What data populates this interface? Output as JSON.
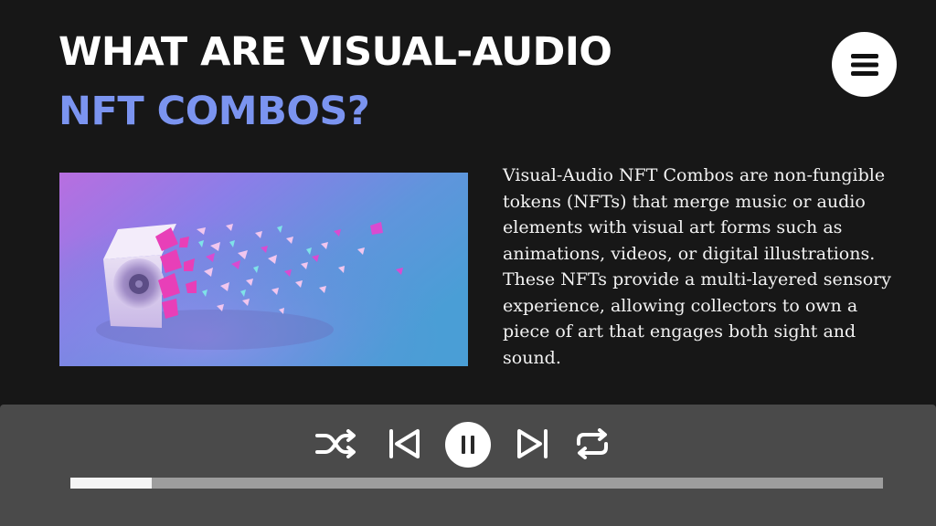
{
  "title": {
    "line1": "WHAT ARE VISUAL-AUDIO",
    "line2": "NFT COMBOS?"
  },
  "description": "Visual-Audio NFT Combos are non-fungible tokens (NFTs) that merge music or audio elements with visual art forms such as animations, videos, or digital illustrations. These NFTs provide a multi-layered sensory experience, allowing collectors to own a piece of art that engages both sight and sound.",
  "menu": {
    "icon": "hamburger-menu-icon"
  },
  "hero_image": {
    "subject": "speaker-shattering-into-fragments"
  },
  "player": {
    "controls": [
      "shuffle-icon",
      "previous-track-icon",
      "pause-icon",
      "next-track-icon",
      "repeat-icon"
    ],
    "progress_fraction": 0.1
  },
  "colors": {
    "background": "#171717",
    "title_primary": "#ffffff",
    "title_accent": "#7b94f0",
    "player_bar": "#4a4a4a",
    "progress_track": "#9d9d9d",
    "progress_fill": "#f4f4f4"
  }
}
